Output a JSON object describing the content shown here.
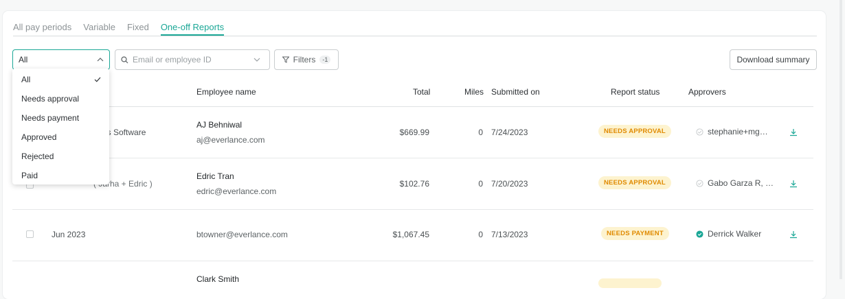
{
  "tabs": [
    {
      "label": "All pay periods",
      "active": false
    },
    {
      "label": "Variable",
      "active": false
    },
    {
      "label": "Fixed",
      "active": false
    },
    {
      "label": "One-off Reports",
      "active": true
    }
  ],
  "toolbar": {
    "status_select": {
      "value": "All"
    },
    "search": {
      "placeholder": "Email or employee ID"
    },
    "filters": {
      "label": "Filters",
      "badge": "-1"
    },
    "download_summary": "Download summary"
  },
  "dropdown": {
    "options": [
      "All",
      "Needs approval",
      "Needs payment",
      "Approved",
      "Rejected",
      "Paid"
    ],
    "selected": "All"
  },
  "table": {
    "headers": {
      "employee_name": "Employee name",
      "total": "Total",
      "miles": "Miles",
      "submitted_on": "Submitted on",
      "report_status": "Report status",
      "approvers": "Approvers"
    },
    "rows": [
      {
        "period": "us Software",
        "name": "AJ Behniwal",
        "email": "aj@everlance.com",
        "total": "$669.99",
        "miles": "0",
        "submitted": "7/24/2023",
        "status": "NEEDS APPROVAL",
        "approver": "stephanie+mg…",
        "approver_state": "pending"
      },
      {
        "period": "( Jarha + Edric )",
        "name": "Edric Tran",
        "email": "edric@everlance.com",
        "total": "$102.76",
        "miles": "0",
        "submitted": "7/20/2023",
        "status": "NEEDS APPROVAL",
        "approver": "Gabo Garza R, …",
        "approver_state": "pending"
      },
      {
        "period": "Jun 2023",
        "name": "",
        "email": "btowner@everlance.com",
        "total": "$1,067.45",
        "miles": "0",
        "submitted": "7/13/2023",
        "status": "NEEDS PAYMENT",
        "approver": "Derrick Walker",
        "approver_state": "approved"
      },
      {
        "period": "",
        "name": "Clark Smith",
        "email": "",
        "total": "",
        "miles": "",
        "submitted": "",
        "status": "",
        "approver": "",
        "approver_state": ""
      }
    ]
  },
  "colors": {
    "accent": "#1aa796",
    "badge_bg": "#fdf3cf",
    "badge_text": "#e08a00"
  },
  "icons": {
    "select_caret": "chevron-up-icon",
    "search": "search-icon",
    "search_caret": "chevron-down-icon",
    "filters": "funnel-icon",
    "selected_check": "check-icon",
    "approver_pending": "circle-check-outline-icon",
    "approver_approved": "circle-check-filled-icon",
    "download": "download-icon"
  }
}
